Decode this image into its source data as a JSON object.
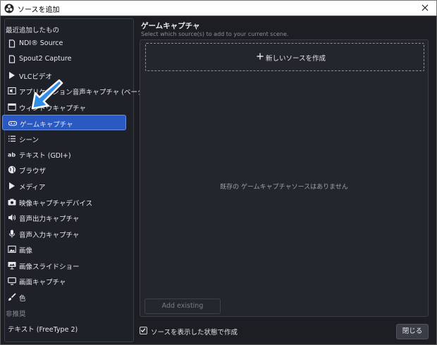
{
  "window": {
    "title": "ソースを追加"
  },
  "sidebar": {
    "recent_header": "最近追加したもの",
    "items": [
      {
        "label": "NDI® Source",
        "icon": "document-icon"
      },
      {
        "label": "Spout2 Capture",
        "icon": "document-icon"
      },
      {
        "label": "VLCビデオ",
        "icon": "play-icon"
      },
      {
        "label": "アプリケーション音声キャプチャ (ベータ版)",
        "icon": "app-audio-icon"
      },
      {
        "label": "ウィンドウキャプチャ",
        "icon": "window-icon"
      },
      {
        "label": "ゲームキャプチャ",
        "icon": "gamepad-icon",
        "selected": true
      },
      {
        "label": "シーン",
        "icon": "list-icon"
      },
      {
        "label": "テキスト (GDI+)",
        "icon": "text-icon"
      },
      {
        "label": "ブラウザ",
        "icon": "globe-icon"
      },
      {
        "label": "メディア",
        "icon": "play-icon"
      },
      {
        "label": "映像キャプチャデバイス",
        "icon": "camera-icon"
      },
      {
        "label": "音声出力キャプチャ",
        "icon": "speaker-icon"
      },
      {
        "label": "音声入力キャプチャ",
        "icon": "microphone-icon"
      },
      {
        "label": "画像",
        "icon": "image-icon"
      },
      {
        "label": "画像スライドショー",
        "icon": "slideshow-icon"
      },
      {
        "label": "画面キャプチャ",
        "icon": "monitor-icon"
      },
      {
        "label": "色",
        "icon": "brush-icon"
      }
    ],
    "deprecated_header": "非推奨",
    "deprecated_items": [
      {
        "label": "テキスト (FreeType 2)"
      }
    ]
  },
  "main": {
    "title": "ゲームキャプチャ",
    "subtitle": "Select which source(s) to add to your current scene.",
    "new_source_label": "新しいソースを作成",
    "empty_message": "既存の ゲームキャプチャソースはありません",
    "add_existing_label": "Add existing"
  },
  "footer": {
    "visible_label": "ソースを表示した状態で作成",
    "visible_checked": true,
    "close_label": "閉じる"
  },
  "colors": {
    "accent": "#2b59c3",
    "arrow": "#2e8ee8"
  }
}
